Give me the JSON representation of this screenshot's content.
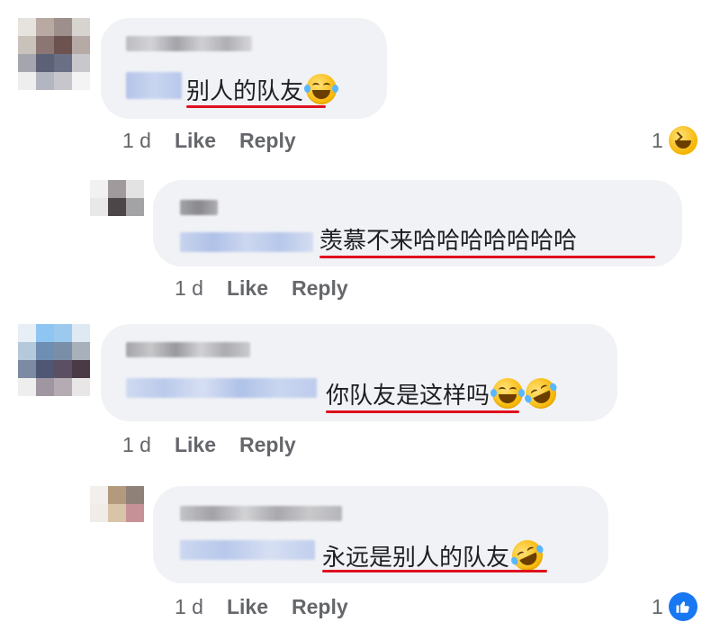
{
  "comments": [
    {
      "message": "别人的队友",
      "time": "1 d",
      "like_label": "Like",
      "reply_label": "Reply",
      "reaction_count": "1",
      "reaction_type": "haha-icon"
    },
    {
      "message": "羡慕不来哈哈哈哈哈哈哈",
      "time": "1 d",
      "like_label": "Like",
      "reply_label": "Reply"
    },
    {
      "message": "你队友是这样吗",
      "time": "1 d",
      "like_label": "Like",
      "reply_label": "Reply"
    },
    {
      "message": "永远是别人的队友",
      "time": "1 d",
      "like_label": "Like",
      "reply_label": "Reply",
      "reaction_count": "1",
      "reaction_type": "like-icon"
    }
  ],
  "colors": {
    "bubble": "#f0f2f5",
    "underline": "#e0101e",
    "meta_text": "#65676b",
    "like_blue": "#1877f2"
  }
}
